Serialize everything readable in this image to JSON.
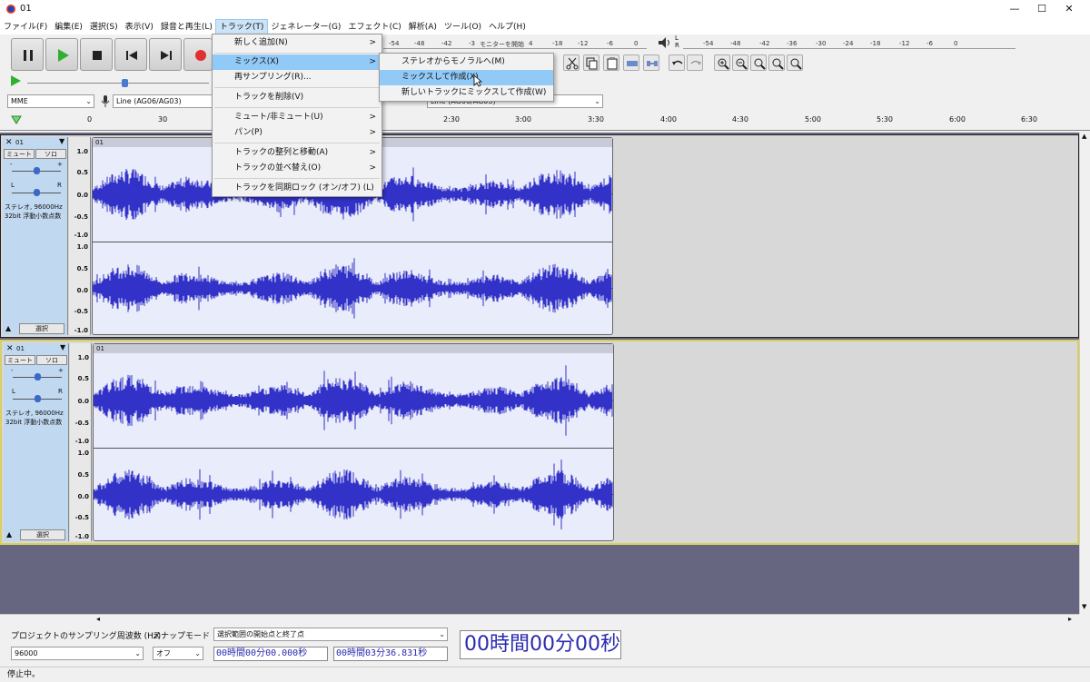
{
  "window": {
    "title": "01",
    "controls": [
      "—",
      "☐",
      "✕"
    ]
  },
  "menubar": [
    "ファイル(F)",
    "編集(E)",
    "選択(S)",
    "表示(V)",
    "録音と再生(L)",
    "トラック(T)",
    "ジェネレーター(G)",
    "エフェクト(C)",
    "解析(A)",
    "ツール(O)",
    "ヘルプ(H)"
  ],
  "track_menu": {
    "items": [
      {
        "label": "新しく追加(N)",
        "submenu": true
      },
      {
        "label": "ミックス(X)",
        "submenu": true,
        "highlighted": true
      },
      {
        "label": "再サンプリング(R)...",
        "submenu": false
      },
      {
        "label": "トラックを削除(V)",
        "submenu": false
      },
      {
        "label": "ミュート/非ミュート(U)",
        "submenu": true
      },
      {
        "label": "パン(P)",
        "submenu": true
      },
      {
        "label": "トラックの整列と移動(A)",
        "submenu": true
      },
      {
        "label": "トラックの並べ替え(O)",
        "submenu": true
      },
      {
        "label": "トラックを同期ロック (オン/オフ) (L)",
        "submenu": false
      }
    ]
  },
  "mix_submenu": {
    "items": [
      {
        "label": "ステレオからモノラルへ(M)",
        "highlighted": false
      },
      {
        "label": "ミックスして作成(X)",
        "highlighted": true
      },
      {
        "label": "新しいトラックにミックスして作成(W)",
        "highlighted": false
      }
    ]
  },
  "meters": {
    "record_ticks": [
      "-54",
      "-48",
      "-42",
      "-3",
      "モニターを開始",
      "4",
      "-18",
      "-12",
      "-6",
      "0"
    ],
    "play_ticks": [
      "-54",
      "-48",
      "-42",
      "-36",
      "-30",
      "-24",
      "-18",
      "-12",
      "-6",
      "0"
    ],
    "lr": [
      "L",
      "R"
    ]
  },
  "devices": {
    "host": "MME",
    "recording": "Line (AG06/AG03)",
    "playback": "Line (AG06/AG03)"
  },
  "ruler": {
    "ticks": [
      "0",
      "30",
      "2:30",
      "3:00",
      "3:30",
      "4:00",
      "4:30",
      "5:00",
      "5:30",
      "6:00",
      "6:30"
    ]
  },
  "tracks": [
    {
      "name": "01",
      "clip_name": "01",
      "mute": "ミュート",
      "solo": "ソロ",
      "gain_marks": [
        "-",
        "+"
      ],
      "pan_marks": [
        "L",
        "R"
      ],
      "info_line1": "ステレオ, 96000Hz",
      "info_line2": "32bit 浮動小数点数",
      "select": "選択",
      "scale": [
        "1.0",
        "0.5",
        "0.0",
        "-0.5",
        "-1.0"
      ]
    },
    {
      "name": "01",
      "clip_name": "01",
      "mute": "ミュート",
      "solo": "ソロ",
      "gain_marks": [
        "-",
        "+"
      ],
      "pan_marks": [
        "L",
        "R"
      ],
      "info_line1": "ステレオ, 96000Hz",
      "info_line2": "32bit 浮動小数点数",
      "select": "選択",
      "scale": [
        "1.0",
        "0.5",
        "0.0",
        "-0.5",
        "-1.0"
      ]
    }
  ],
  "bottom": {
    "rate_label": "プロジェクトのサンプリング周波数 (Hz)",
    "rate_value": "96000",
    "snap_label": "スナップモード",
    "snap_value": "オフ",
    "selection_label": "選択範囲の開始点と終了点",
    "sel_start": "00時間00分00.000秒",
    "sel_end": "00時間03分36.831秒",
    "big_time": "00時間00分00秒"
  },
  "status": "停止中。",
  "colors": {
    "waveform": "#3232c8",
    "menu_highlight": "#91c9f7",
    "track_bg": "#c0d8f0",
    "selected_border": "#d8d060"
  }
}
